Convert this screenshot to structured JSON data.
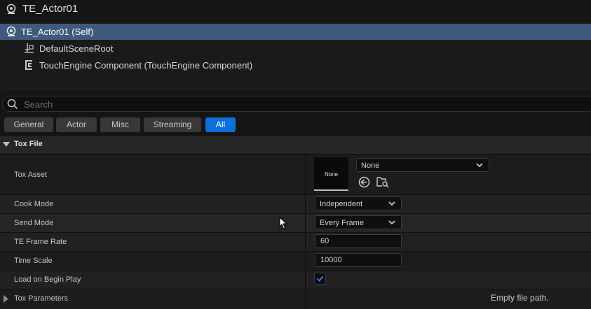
{
  "window": {
    "title": "TE_Actor01",
    "title_icon": "actor-icon"
  },
  "tree": {
    "items": [
      {
        "label": "TE_Actor01 (Self)",
        "icon": "actor-icon",
        "selected": true
      },
      {
        "label": "DefaultSceneRoot",
        "icon": "scene-root-icon",
        "selected": false
      },
      {
        "label": "TouchEngine Component (TouchEngine Component)",
        "icon": "component-icon",
        "selected": false
      }
    ]
  },
  "search": {
    "placeholder": "Search",
    "value": ""
  },
  "filters": {
    "tabs": [
      {
        "label": "General",
        "active": false
      },
      {
        "label": "Actor",
        "active": false
      },
      {
        "label": "Misc",
        "active": false
      },
      {
        "label": "Streaming",
        "active": false
      },
      {
        "label": "All",
        "active": true
      }
    ]
  },
  "details": {
    "section_title": "Tox File",
    "tox_asset": {
      "label": "Tox Asset",
      "thumbnail_text": "None",
      "dropdown_value": "None",
      "browse_icon": "use-selected-arrow-icon",
      "find_icon": "browse-folder-icon"
    },
    "cook_mode": {
      "label": "Cook Mode",
      "value": "Independent"
    },
    "send_mode": {
      "label": "Send Mode",
      "value": "Every Frame"
    },
    "te_frame_rate": {
      "label": "TE Frame Rate",
      "value": "60"
    },
    "time_scale": {
      "label": "Time Scale",
      "value": "10000"
    },
    "load_on_begin_play": {
      "label": "Load on Begin Play",
      "checked": true
    },
    "tox_parameters": {
      "label": "Tox Parameters",
      "status": "Empty file path."
    }
  },
  "colors": {
    "selected_row": "#3e5a7c",
    "active_tab": "#0e6fd8",
    "checkmark": "#2f86f0"
  }
}
